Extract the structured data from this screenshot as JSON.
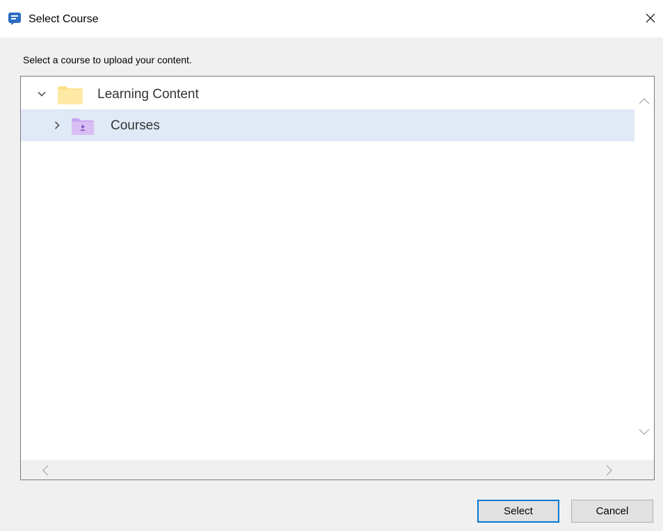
{
  "window": {
    "title": "Select Course",
    "icon": "chat-app-icon",
    "close_icon": "close-icon"
  },
  "instruction": "Select a course to upload your content.",
  "tree": {
    "items": [
      {
        "label": "Learning Content",
        "expanded": true,
        "icon": "folder-icon",
        "level": 0
      },
      {
        "label": "Courses",
        "expanded": false,
        "selected": true,
        "icon": "shared-folder-icon",
        "level": 1
      }
    ]
  },
  "buttons": {
    "select": "Select",
    "cancel": "Cancel"
  },
  "colors": {
    "accent": "#0078d7",
    "selection": "#e0eaf6",
    "folder": "#ffe08a",
    "shared_folder": "#c9a6ef"
  }
}
